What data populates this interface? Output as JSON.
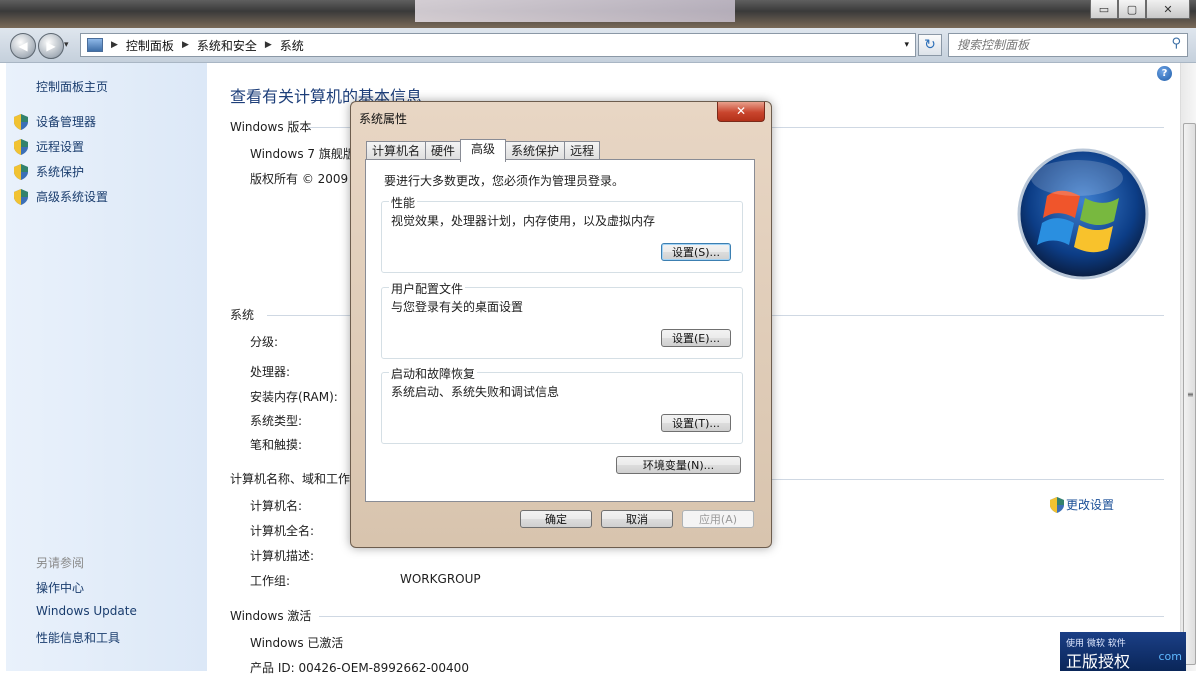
{
  "window": {
    "caption_buttons": {
      "minimize": "▭",
      "maximize": "▢",
      "close": "✕"
    }
  },
  "navigation": {
    "back_icon": "◀",
    "forward_icon": "▶",
    "dropdown_icon": "▾",
    "breadcrumb": [
      "控制面板",
      "系统和安全",
      "系统"
    ],
    "address_dropdown_icon": "▾",
    "refresh_icon": "↻",
    "search_placeholder": "搜索控制面板",
    "search_icon": "⚲"
  },
  "sidebar": {
    "home": "控制面板主页",
    "tasks": [
      "设备管理器",
      "远程设置",
      "系统保护",
      "高级系统设置"
    ],
    "see_also_heading": "另请参阅",
    "see_also": [
      "操作中心",
      "Windows Update",
      "性能信息和工具"
    ]
  },
  "main": {
    "help_icon": "?",
    "title": "查看有关计算机的基本信息",
    "edition_heading": "Windows 版本",
    "edition_name": "Windows 7 旗舰版",
    "copyright": "版权所有 © 2009",
    "system_heading": "系统",
    "system_rows": [
      "分级:",
      "处理器:",
      "安装内存(RAM):",
      "系统类型:",
      "笔和触摸:"
    ],
    "computer_heading": "计算机名称、域和工作组设置",
    "computer_rows": [
      "计算机名:",
      "计算机全名:",
      "计算机描述:",
      "工作组:"
    ],
    "workgroup_value": "WORKGROUP",
    "change_settings": "更改设置",
    "activation_heading": "Windows 激活",
    "activation_status": "Windows 已激活",
    "product_id_partial": "产品 ID: 00426-OEM-8992662-00400"
  },
  "watermark": {
    "small": "使用 微软 软件",
    "big": "正版授权",
    "site": "com"
  },
  "dialog": {
    "title": "系统属性",
    "close": "✕",
    "tabs": [
      "计算机名",
      "硬件",
      "高级",
      "系统保护",
      "远程"
    ],
    "active_tab": "高级",
    "admin_note": "要进行大多数更改，您必须作为管理员登录。",
    "performance": {
      "label": "性能",
      "desc": "视觉效果，处理器计划，内存使用，以及虚拟内存",
      "button": "设置(S)..."
    },
    "profiles": {
      "label": "用户配置文件",
      "desc": "与您登录有关的桌面设置",
      "button": "设置(E)..."
    },
    "startup": {
      "label": "启动和故障恢复",
      "desc": "系统启动、系统失败和调试信息",
      "button": "设置(T)..."
    },
    "env_button": "环境变量(N)...",
    "ok": "确定",
    "cancel": "取消",
    "apply": "应用(A)"
  }
}
